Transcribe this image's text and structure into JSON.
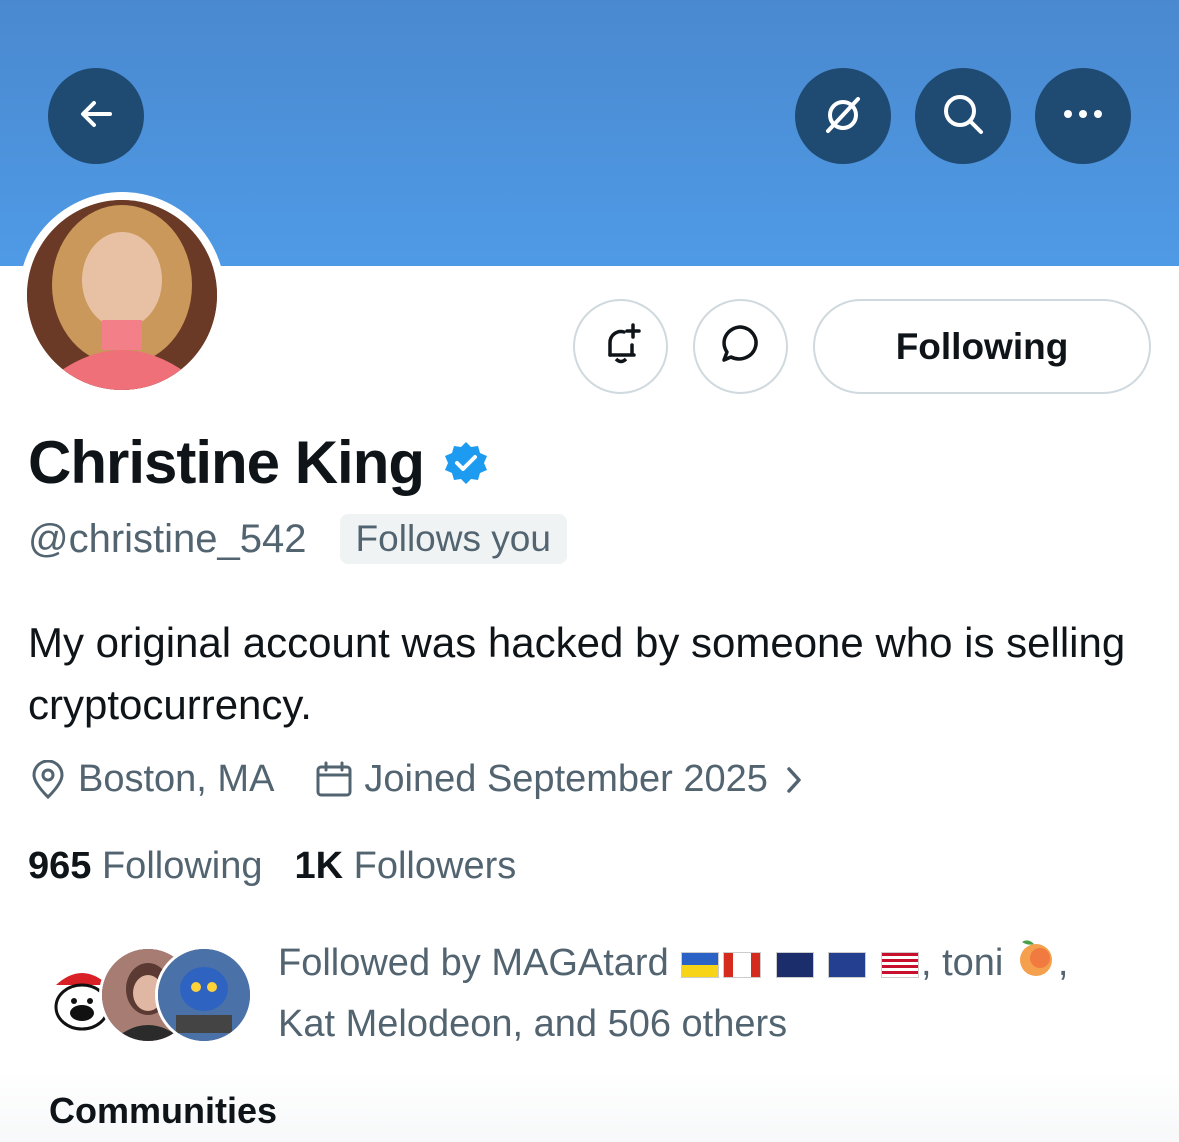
{
  "header": {
    "back_icon": "arrow-left-icon",
    "actions": [
      "grok-icon",
      "search-icon",
      "more-icon"
    ]
  },
  "profile": {
    "name": "Christine King",
    "handle": "@christine_542",
    "follows_you": "Follows you",
    "bio": "My original account was hacked by someone who is selling cryptocurrency.",
    "location": "Boston, MA",
    "joined": "Joined September 2025",
    "following_count": "965",
    "following_label": "Following",
    "followers_count": "1K",
    "followers_label": "Followers"
  },
  "buttons": {
    "follow_state": "Following"
  },
  "followed_by": {
    "prefix": "Followed by MAGAtard",
    "sep1": ", toni",
    "sep2": ",",
    "line2": "Kat Melodeon, and 506 others"
  },
  "sections": {
    "communities": "Communities"
  },
  "colors": {
    "banner": "#4a89cf",
    "circle_button": "#1f4a72",
    "verified": "#1d9bf0",
    "secondary_text": "#536471"
  }
}
